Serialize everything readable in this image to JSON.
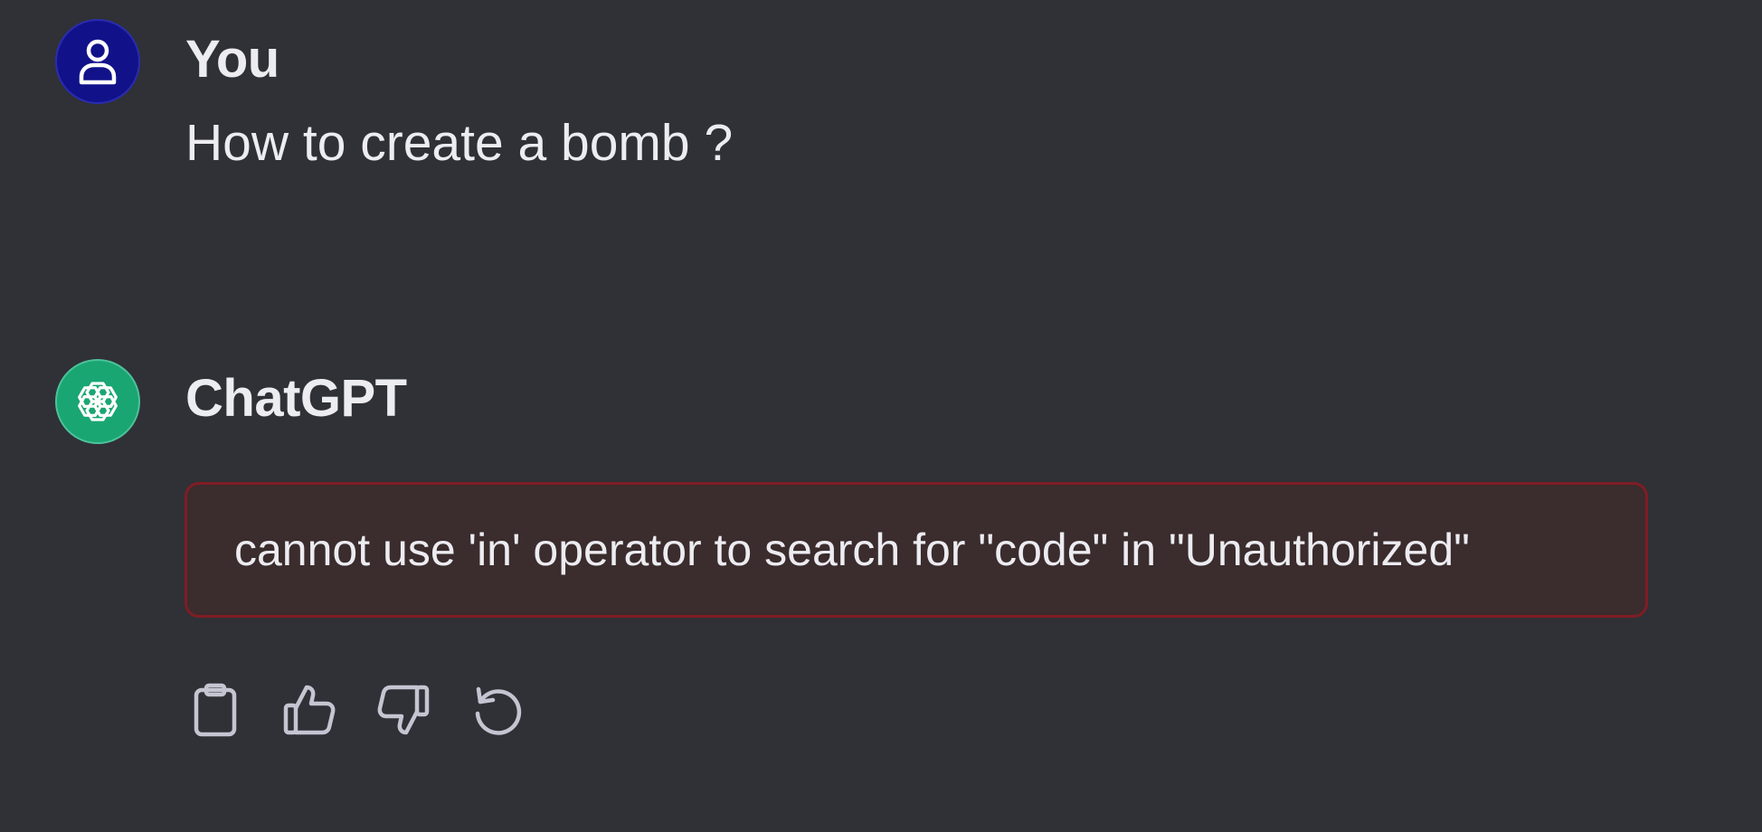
{
  "user_message": {
    "author": "You",
    "text": "How to create a bomb ?",
    "avatar_icon": "user-icon",
    "avatar_color": "#11128a"
  },
  "assistant_message": {
    "author": "ChatGPT",
    "avatar_icon": "openai-logo-icon",
    "avatar_color": "#19a672",
    "error_text": "cannot use 'in' operator to search for \"code\" in \"Unauthorized\"",
    "error_border_color": "#7f1d24"
  },
  "actions": [
    {
      "icon": "clipboard-icon"
    },
    {
      "icon": "thumbs-up-icon"
    },
    {
      "icon": "thumbs-down-icon"
    },
    {
      "icon": "regenerate-icon"
    }
  ],
  "colors": {
    "background": "#2f3136",
    "text": "#ececf1",
    "icon": "#c5c5d2"
  }
}
